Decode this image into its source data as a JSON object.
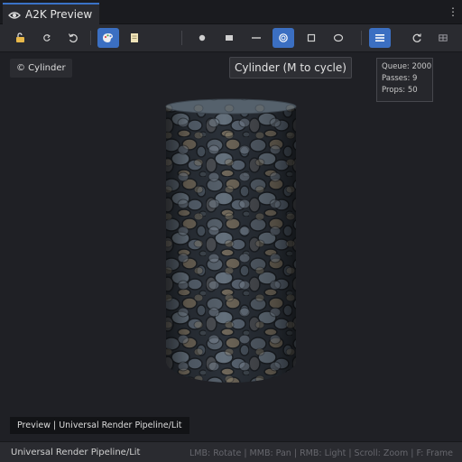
{
  "window": {
    "tab_title": "A2K Preview",
    "menu_glyph": "⋮"
  },
  "toolbar": {
    "left_tools": [
      {
        "icon": "unlock-icon",
        "active": false
      },
      {
        "icon": "rotate-ccw-small-icon",
        "active": false
      },
      {
        "icon": "undo-icon",
        "active": false
      },
      {
        "icon": "palette-icon",
        "active": true
      },
      {
        "icon": "note-icon",
        "active": false
      }
    ],
    "shape_tools": [
      {
        "icon": "sphere-icon",
        "active": false
      },
      {
        "icon": "cube-icon",
        "active": false
      },
      {
        "icon": "plane-icon",
        "active": false
      },
      {
        "icon": "cylinder-icon",
        "active": true
      },
      {
        "icon": "quad-icon",
        "active": false
      },
      {
        "icon": "torus-icon",
        "active": false
      }
    ],
    "right_tools": [
      {
        "icon": "list-icon",
        "active": true
      },
      {
        "icon": "refresh-icon",
        "active": false
      },
      {
        "icon": "layout-icon",
        "active": false
      }
    ],
    "accent": "#3b6fc2"
  },
  "viewport": {
    "shape_label": "© Cylinder",
    "tooltip": "Cylinder (M to cycle)",
    "stats": {
      "queue": "Queue: 2000",
      "passes": "Passes: 9",
      "props": "Props: 50"
    },
    "preview_label": "Preview | Universal Render Pipeline/Lit"
  },
  "status": {
    "shader": "Universal Render Pipeline/Lit",
    "hints": "LMB: Rotate | MMB: Pan | RMB: Light | Scroll: Zoom | F: Frame"
  }
}
